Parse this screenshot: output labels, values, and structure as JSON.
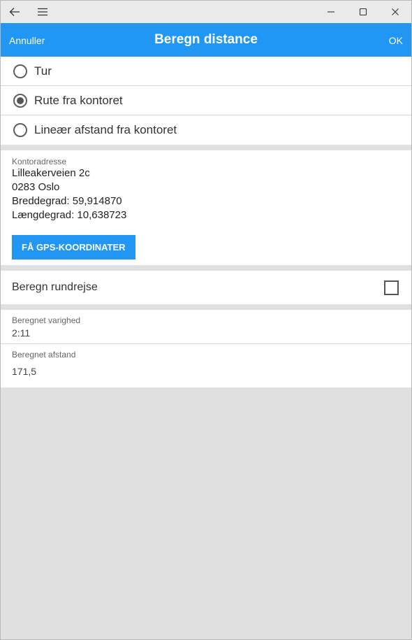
{
  "header": {
    "cancel_label": "Annuller",
    "title": "Beregn distance",
    "ok_label": "OK"
  },
  "mode_options": [
    {
      "label": "Tur",
      "selected": false
    },
    {
      "label": "Rute fra kontoret",
      "selected": true
    },
    {
      "label": "Lineær afstand fra kontoret",
      "selected": false
    }
  ],
  "office": {
    "label": "Kontoradresse",
    "street": "Lilleakerveien 2c",
    "city": "0283 Oslo",
    "latitude": "Breddegrad: 59,914870",
    "longitude": "Længdegrad: 10,638723",
    "gps_button_label": "FÅ GPS-KOORDINATER"
  },
  "round_trip": {
    "label": "Beregn rundrejse",
    "checked": false
  },
  "calculated_duration": {
    "label": "Beregnet varighed",
    "value": "2:11"
  },
  "calculated_distance": {
    "label": "Beregnet afstand",
    "value": "171,5"
  },
  "colors": {
    "accent": "#2196f3",
    "background": "#e0e0e0"
  }
}
